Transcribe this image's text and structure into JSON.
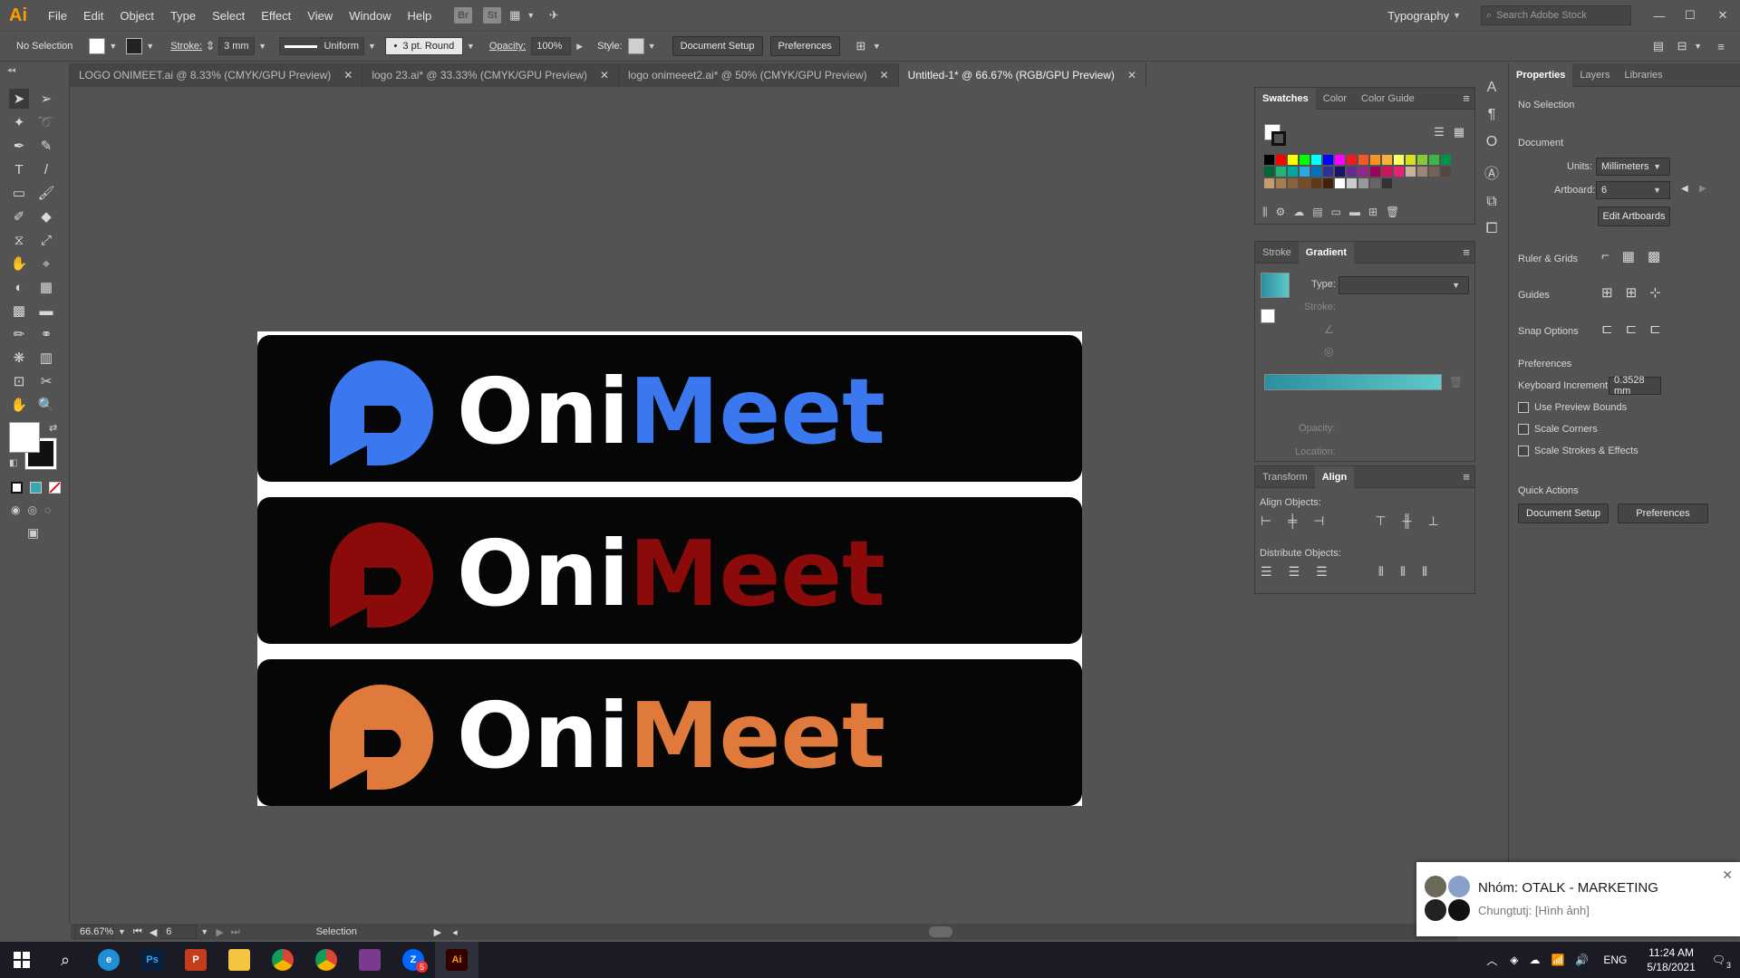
{
  "app": {
    "logo": "Ai",
    "menu": [
      "File",
      "Edit",
      "Object",
      "Type",
      "Select",
      "Effect",
      "View",
      "Window",
      "Help"
    ],
    "workspace": "Typography",
    "search_placeholder": "Search Adobe Stock",
    "bridge_label": "Br",
    "stock_label": "St"
  },
  "control_bar": {
    "selection": "No Selection",
    "stroke_label": "Stroke:",
    "stroke_value": "3 mm",
    "profile": "Uniform",
    "brush": "3 pt. Round",
    "opacity_label": "Opacity:",
    "opacity_value": "100%",
    "style_label": "Style:",
    "document_setup": "Document Setup",
    "preferences": "Preferences"
  },
  "tabs": [
    {
      "label": "LOGO ONIMEET.ai @ 8.33% (CMYK/GPU Preview)"
    },
    {
      "label": "logo 23.ai* @ 33.33% (CMYK/GPU Preview)"
    },
    {
      "label": "logo onimeeet2.ai* @ 50% (CMYK/GPU Preview)"
    },
    {
      "label": "Untitled-1* @ 66.67% (RGB/GPU Preview)"
    }
  ],
  "artwork": {
    "logos": [
      {
        "word1": "Oni",
        "word2": "Meet",
        "color": "#3b78f0"
      },
      {
        "word1": "Oni",
        "word2": "Meet",
        "color": "#8b0a0a"
      },
      {
        "word1": "Oni",
        "word2": "Meet",
        "color": "#e07a3c"
      }
    ]
  },
  "status": {
    "zoom": "66.67%",
    "artboard": "6",
    "tool": "Selection"
  },
  "swatches_panel": {
    "tabs": [
      "Swatches",
      "Color",
      "Color Guide"
    ],
    "colors": [
      "#000000",
      "#ff0000",
      "#ffff00",
      "#00ff00",
      "#00ffff",
      "#0000ff",
      "#ff00ff",
      "#ed1c24",
      "#f15a24",
      "#f7931e",
      "#fbb03b",
      "#ffff66",
      "#d9e021",
      "#8cc63f",
      "#39b54a",
      "#009245",
      "#006837",
      "#22b573",
      "#00a99d",
      "#29abe2",
      "#0071bc",
      "#2e3192",
      "#1b1464",
      "#662d91",
      "#93278f",
      "#9e005d",
      "#d4145a",
      "#ed1e79",
      "#c7b299",
      "#998675",
      "#736357",
      "#534741",
      "#c69c6d",
      "#a67c52",
      "#8c6239",
      "#754c24",
      "#603813",
      "#42210b",
      "#ffffff",
      "#cccccc",
      "#999999",
      "#666666",
      "#333333"
    ]
  },
  "gradient_panel": {
    "tabs": [
      "Stroke",
      "Gradient"
    ],
    "type_label": "Type:",
    "stroke_label": "Stroke:",
    "opacity_label": "Opacity:",
    "location_label": "Location:",
    "gradient_start": "#2b8fa0",
    "gradient_end": "#5fc8c8"
  },
  "align_panel": {
    "tabs": [
      "Transform",
      "Align"
    ],
    "align_objects": "Align Objects:",
    "distribute_objects": "Distribute Objects:"
  },
  "properties": {
    "tabs": [
      "Properties",
      "Layers",
      "Libraries"
    ],
    "selection": "No Selection",
    "document": "Document",
    "units_label": "Units:",
    "units_value": "Millimeters",
    "artboard_label": "Artboard:",
    "artboard_value": "6",
    "edit_artboards": "Edit Artboards",
    "ruler_grids": "Ruler & Grids",
    "guides": "Guides",
    "snap_options": "Snap Options",
    "preferences": "Preferences",
    "keyboard_increment_label": "Keyboard Increment:",
    "keyboard_increment_value": "0.3528 mm",
    "use_preview_bounds": "Use Preview Bounds",
    "scale_corners": "Scale Corners",
    "scale_strokes": "Scale Strokes & Effects",
    "quick_actions": "Quick Actions",
    "document_setup": "Document Setup",
    "preferences_btn": "Preferences"
  },
  "notification": {
    "title": "Nhóm: OTALK - MARKETING",
    "message": "Chungtutj: [Hình ảnh]"
  },
  "taskbar": {
    "language": "ENG",
    "time": "11:24 AM",
    "date": "5/18/2021",
    "notif_count": "3",
    "zalo_badge": "5"
  }
}
